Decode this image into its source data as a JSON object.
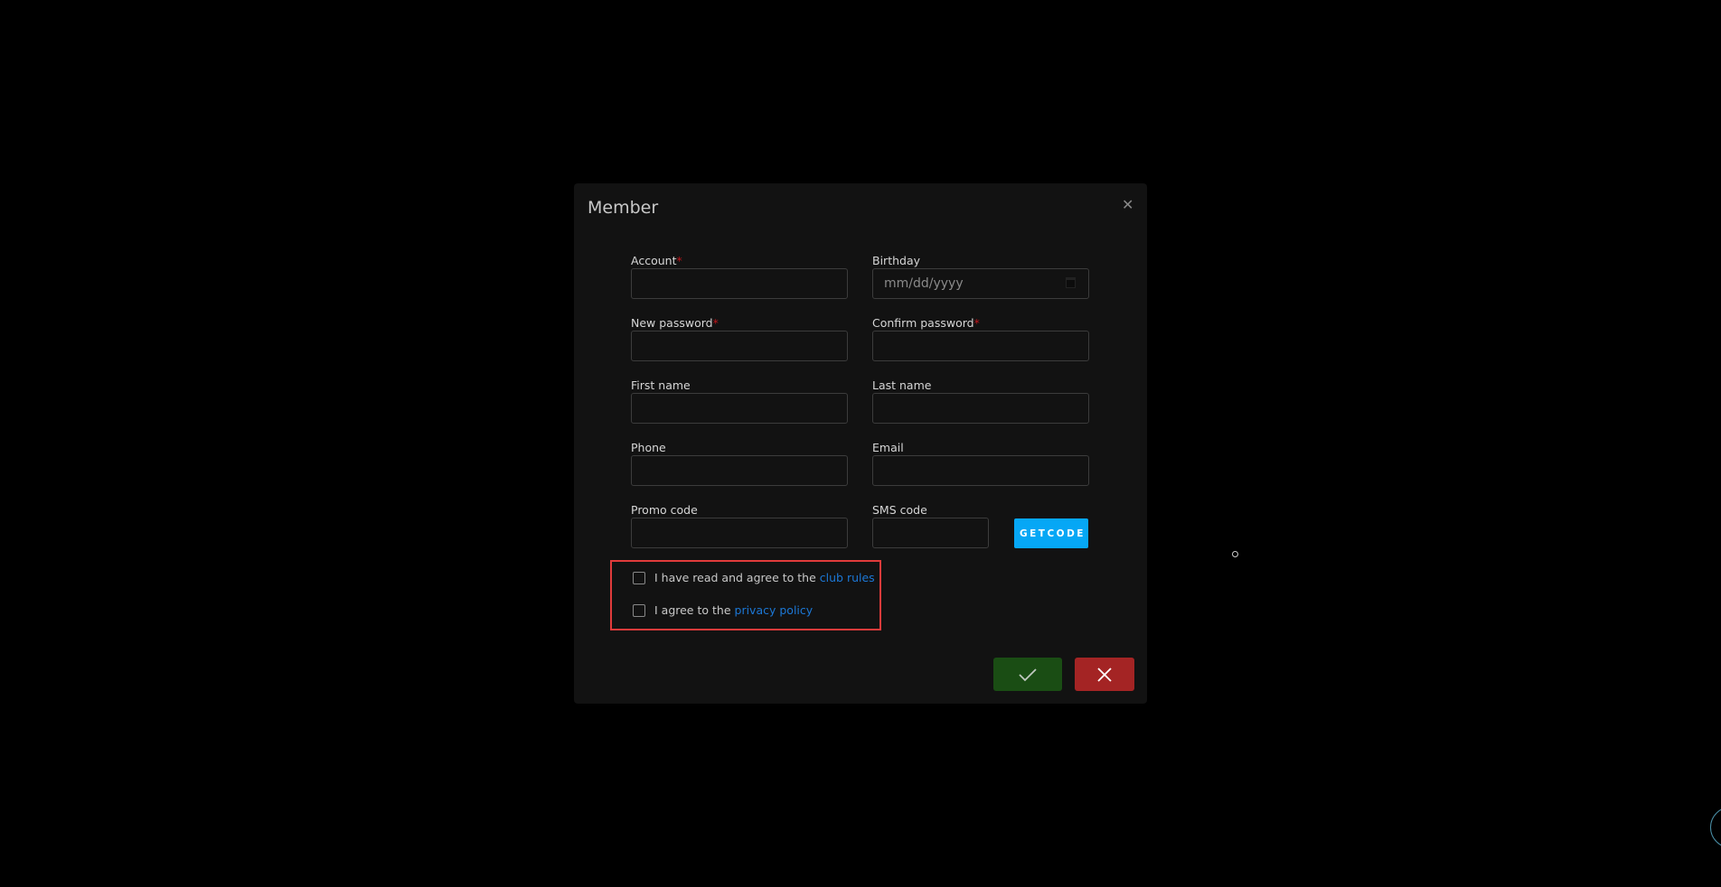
{
  "dialog": {
    "title": "Member",
    "close_icon": "close-icon",
    "fields": [
      {
        "label": "Account",
        "required": "*",
        "value": ""
      },
      {
        "label": "Birthday",
        "placeholder": "mm/dd/yyyy"
      },
      {
        "label": "New password",
        "required": "*",
        "value": ""
      },
      {
        "label": "Confirm password",
        "required": "*",
        "value": ""
      },
      {
        "label": "First name",
        "value": ""
      },
      {
        "label": "Last name",
        "value": ""
      },
      {
        "label": "Phone",
        "value": ""
      },
      {
        "label": "Email",
        "value": ""
      },
      {
        "label": "Promo code",
        "value": ""
      },
      {
        "label": "SMS code",
        "value": ""
      }
    ],
    "getcode_label": "GETCODE",
    "agreements": [
      {
        "text": "I have read and agree to the",
        "link": "club rules"
      },
      {
        "text": "I agree to the",
        "link": "privacy policy"
      }
    ],
    "confirm_icon": "check-icon",
    "cancel_icon": "x-icon"
  }
}
